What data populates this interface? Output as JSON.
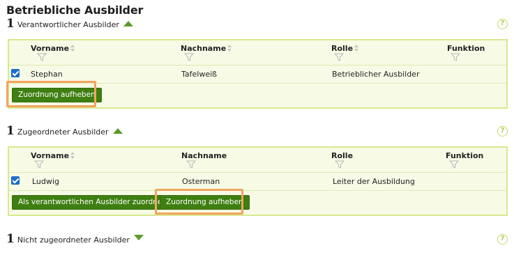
{
  "page": {
    "title": "Betriebliche Ausbilder"
  },
  "columns": {
    "vorname": "Vorname",
    "nachname": "Nachname",
    "rolle": "Rolle",
    "funktion": "Funktion"
  },
  "help_glyph": "?",
  "sections": [
    {
      "count": "1",
      "label": "Verantwortlicher Ausbilder",
      "expanded": true,
      "rows": [
        {
          "checked": true,
          "vorname": "Stephan",
          "nachname": "Tafelweiß",
          "rolle": "Betrieblicher Ausbilder",
          "funktion": ""
        }
      ],
      "actions": {
        "remove": "Zuordnung aufheben"
      }
    },
    {
      "count": "1",
      "label": "Zugeordneter Ausbilder",
      "expanded": true,
      "rows": [
        {
          "checked": true,
          "vorname": "Ludwig",
          "nachname": "Osterman",
          "rolle": "Leiter der Ausbildung",
          "funktion": ""
        }
      ],
      "actions": {
        "assign_responsible": "Als verantwortlichen Ausbilder zuordnen",
        "remove": "Zuordnung aufheben"
      }
    },
    {
      "count": "1",
      "label": "Nicht zugeordneter Ausbilder",
      "expanded": false
    }
  ],
  "colors": {
    "accent_green": "#3f7f12",
    "grid_border": "#d8e88e",
    "grid_bg": "#f7fbe6",
    "highlight": "#f4a460",
    "checkbox": "#1a6fd1"
  },
  "icons": {
    "toggle_up": "chevron-up-icon",
    "toggle_down": "chevron-down-icon",
    "sort": "sort-icon",
    "filter": "filter-icon",
    "help": "help-icon"
  }
}
